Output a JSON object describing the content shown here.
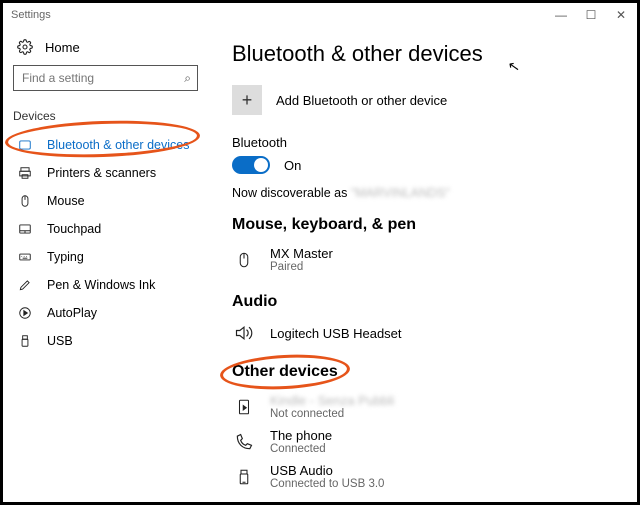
{
  "window": {
    "title": "Settings",
    "minimize": "—",
    "maximize": "☐",
    "close": "✕"
  },
  "sidebar": {
    "home": "Home",
    "search_placeholder": "Find a setting",
    "section": "Devices",
    "items": [
      {
        "label": "Bluetooth & other devices",
        "icon": "bt"
      },
      {
        "label": "Printers & scanners",
        "icon": "printer"
      },
      {
        "label": "Mouse",
        "icon": "mouse"
      },
      {
        "label": "Touchpad",
        "icon": "touchpad"
      },
      {
        "label": "Typing",
        "icon": "typing"
      },
      {
        "label": "Pen & Windows Ink",
        "icon": "pen"
      },
      {
        "label": "AutoPlay",
        "icon": "autoplay"
      },
      {
        "label": "USB",
        "icon": "usb"
      }
    ]
  },
  "page": {
    "title": "Bluetooth & other devices",
    "add_label": "Add Bluetooth or other device",
    "bluetooth_label": "Bluetooth",
    "toggle_state": "On",
    "discover_prefix": "Now discoverable as",
    "discover_name": "\"MARVINLANDS\"",
    "sections": {
      "mouse_kb": {
        "heading": "Mouse, keyboard, & pen",
        "devices": [
          {
            "name": "MX Master",
            "status": "Paired"
          }
        ]
      },
      "audio": {
        "heading": "Audio",
        "devices": [
          {
            "name": "Logitech USB Headset",
            "status": ""
          }
        ]
      },
      "other": {
        "heading": "Other devices",
        "devices": [
          {
            "name": "Kindle - Senza Pubbli",
            "status": "Not connected"
          },
          {
            "name": "The phone",
            "status": "Connected"
          },
          {
            "name": "USB Audio",
            "status": "Connected to USB 3.0"
          }
        ]
      }
    }
  },
  "annotation": {
    "highlight_sidebar_item": 0,
    "highlight_section": "other"
  }
}
